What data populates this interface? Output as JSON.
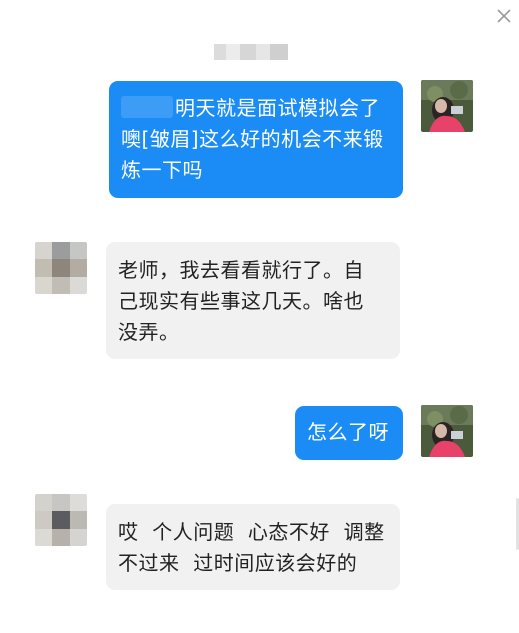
{
  "window": {
    "close_icon": "close-icon"
  },
  "header": {
    "title_redacted": true
  },
  "messages": [
    {
      "side": "me",
      "lines": [
        "明天就是面试模拟会了",
        "噢[皱眉]这么好的机会不来锻",
        "炼一下吗"
      ]
    },
    {
      "side": "them",
      "lines": [
        "老师，我去看看就行了。自",
        "己现实有些事这几天。啥也",
        "没弄。"
      ]
    },
    {
      "side": "me",
      "lines": [
        "怎么了呀"
      ]
    },
    {
      "side": "them",
      "lines": [
        "哎  个人问题  心态不好  调整",
        "不过来  过时间应该会好的"
      ]
    }
  ],
  "colors": {
    "my_bubble": "#1b8cf5",
    "their_bubble": "#f1f1f2",
    "my_text": "#ffffff",
    "their_text": "#222222"
  }
}
